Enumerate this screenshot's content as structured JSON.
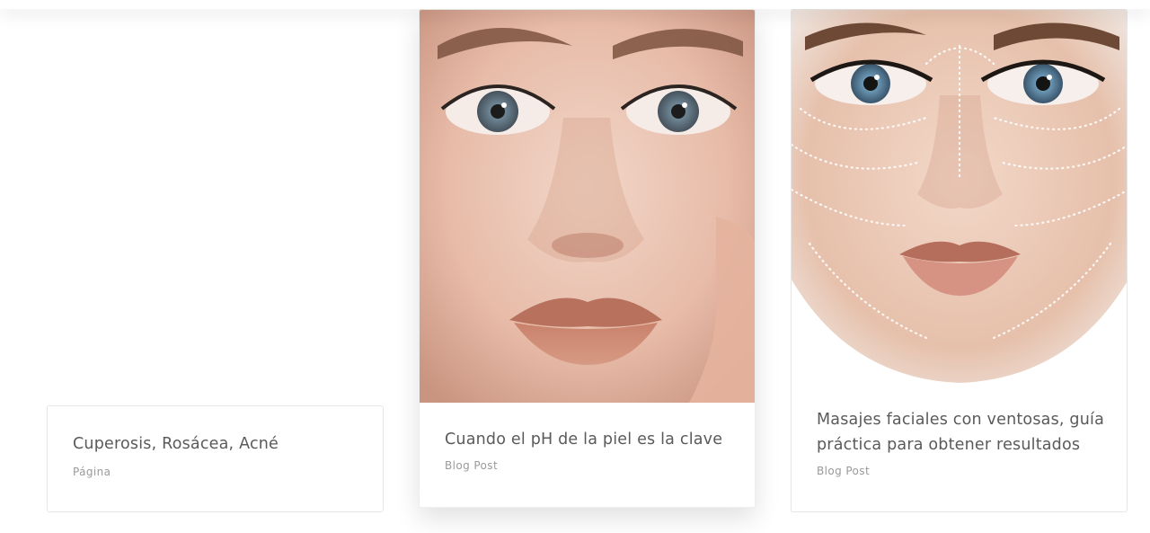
{
  "results": [
    {
      "title": "Cuperosis, Rosácea, Acné",
      "type": "Página",
      "image": "none"
    },
    {
      "title": "Cuando el pH de la piel es la clave",
      "type": "Blog Post",
      "image": "face-closeup-photo"
    },
    {
      "title": "Masajes faciales con ventosas, guía práctica para obtener resultados",
      "type": "Blog Post",
      "image": "face-massage-lines-photo"
    }
  ]
}
